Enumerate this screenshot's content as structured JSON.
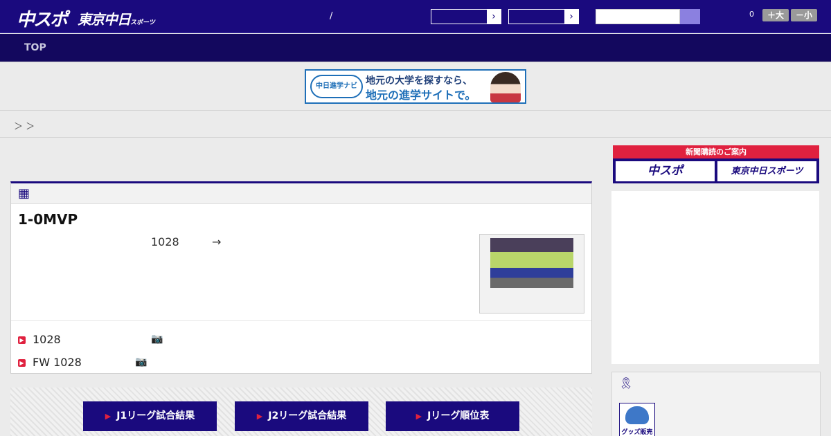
{
  "header": {
    "logo_primary": "中スポ",
    "logo_secondary": "東京中日",
    "logo_secondary_small": "スポーツ",
    "separator": "/",
    "select_arrow": "›",
    "font_count": "0",
    "font_larger": "＋大",
    "font_smaller": "－小"
  },
  "nav": {
    "top": "TOP"
  },
  "banner": {
    "badge": "中日進学ナビ",
    "line1": "地元の大学を探すなら、",
    "line2": "地元の進学サイトで。"
  },
  "breadcrumb": "＞ ＞",
  "article": {
    "title": "1-0MVP",
    "date": "1028",
    "arrow": "→",
    "related": [
      {
        "text": "1028"
      },
      {
        "text": "FW 1028"
      }
    ]
  },
  "buttons": [
    {
      "label": "J1リーグ試合結果"
    },
    {
      "label": "J2リーグ試合結果"
    },
    {
      "label": "Jリーグ順位表"
    }
  ],
  "sidebar": {
    "subscribe_title": "新聞購読のご案内",
    "subscribe_chuspo": "中スポ",
    "subscribe_tokyo": "東京中日スポーツ",
    "goods_label": "グッズ販売中"
  },
  "colors": {
    "brand": "#1a0a7e",
    "accent": "#e0213f"
  }
}
